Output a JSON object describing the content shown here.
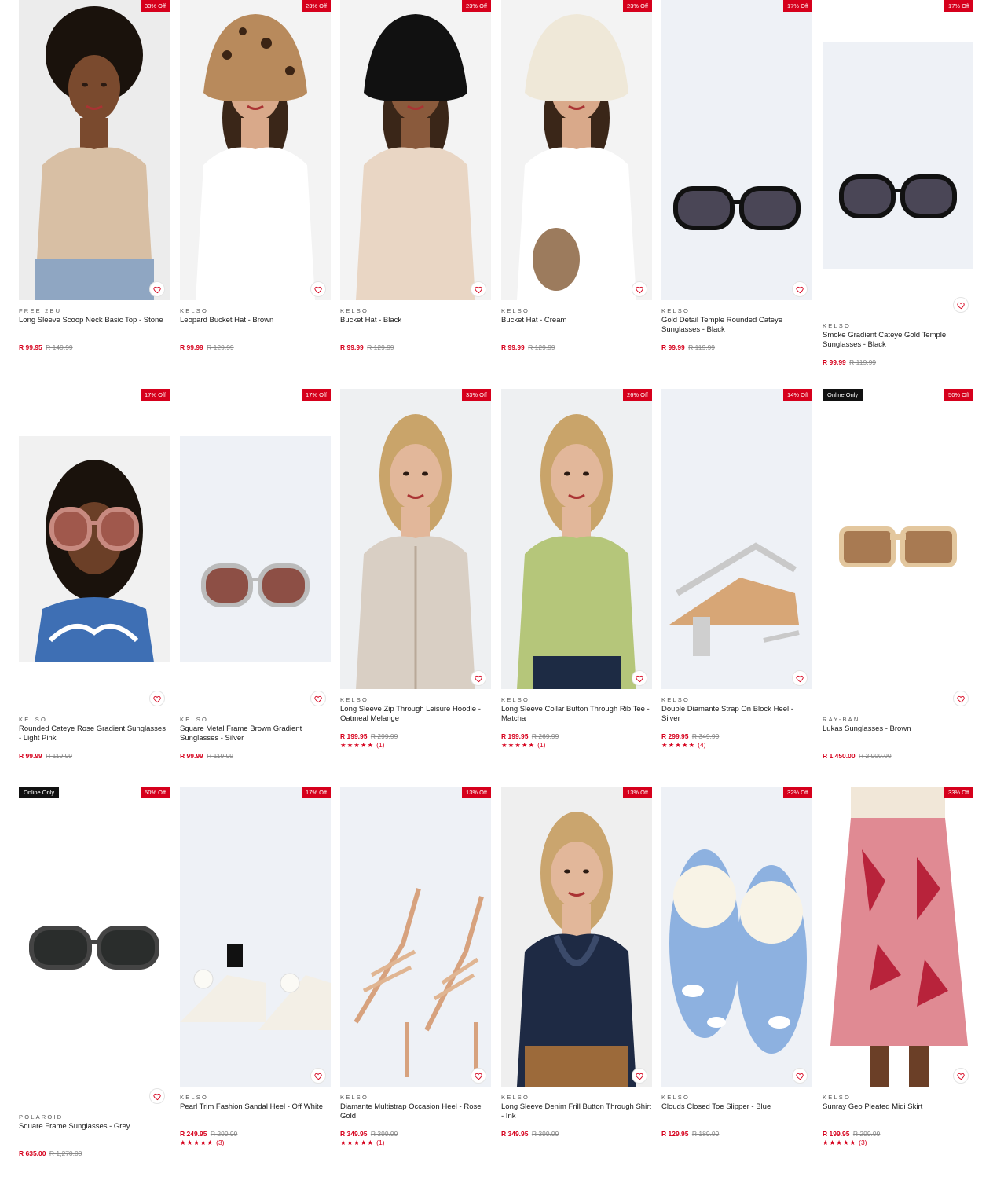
{
  "theme": {
    "accent": "#d6001c",
    "online_badge": "#111111"
  },
  "products": [
    {
      "brand": "FREE 2BU",
      "name": "Long Sleeve Scoop Neck Basic Top - Stone",
      "price": "R 99.95",
      "was_price": "R 149.99",
      "discount": "33% Off",
      "online_only": "",
      "rating_stars": "",
      "rating_count": "",
      "image": "model-scoop-neck-top-stone",
      "wishlist_icon": "heart-outline-icon"
    },
    {
      "brand": "KELSO",
      "name": "Leopard Bucket Hat - Brown",
      "price": "R 99.99",
      "was_price": "R 129.99",
      "discount": "23% Off",
      "online_only": "",
      "rating_stars": "",
      "rating_count": "",
      "image": "model-leopard-bucket-hat",
      "wishlist_icon": "heart-outline-icon"
    },
    {
      "brand": "KELSO",
      "name": "Bucket Hat - Black",
      "price": "R 99.99",
      "was_price": "R 129.99",
      "discount": "23% Off",
      "online_only": "",
      "rating_stars": "",
      "rating_count": "",
      "image": "model-black-bucket-hat",
      "wishlist_icon": "heart-outline-icon"
    },
    {
      "brand": "KELSO",
      "name": "Bucket Hat - Cream",
      "price": "R 99.99",
      "was_price": "R 129.99",
      "discount": "23% Off",
      "online_only": "",
      "rating_stars": "",
      "rating_count": "",
      "image": "model-cream-bucket-hat",
      "wishlist_icon": "heart-outline-icon"
    },
    {
      "brand": "KELSO",
      "name": "Gold Detail Temple Rounded Cateye Sunglasses - Black",
      "price": "R 99.99",
      "was_price": "R 119.99",
      "discount": "17% Off",
      "online_only": "",
      "rating_stars": "",
      "rating_count": "",
      "image": "sunglasses-black-cateye",
      "wishlist_icon": "heart-outline-icon"
    },
    {
      "brand": "KELSO",
      "name": "Smoke Gradient Cateye Gold Temple Sunglasses - Black",
      "price": "R 99.99",
      "was_price": "R 119.99",
      "discount": "17% Off",
      "online_only": "",
      "rating_stars": "",
      "rating_count": "",
      "image": "sunglasses-smoke-cateye",
      "wishlist_icon": "heart-outline-icon"
    },
    {
      "brand": "KELSO",
      "name": "Rounded Cateye Rose Gradient Sunglasses - Light Pink",
      "price": "R 99.99",
      "was_price": "R 119.99",
      "discount": "17% Off",
      "online_only": "",
      "rating_stars": "",
      "rating_count": "",
      "image": "model-rose-sunglasses",
      "wishlist_icon": "heart-outline-icon"
    },
    {
      "brand": "KELSO",
      "name": "Square Metal Frame Brown Gradient Sunglasses - Silver",
      "price": "R 99.99",
      "was_price": "R 119.99",
      "discount": "17% Off",
      "online_only": "",
      "rating_stars": "",
      "rating_count": "",
      "image": "sunglasses-metal-brown",
      "wishlist_icon": "heart-outline-icon"
    },
    {
      "brand": "KELSO",
      "name": "Long Sleeve Zip Through Leisure Hoodie - Oatmeal Melange",
      "price": "R 199.95",
      "was_price": "R 299.99",
      "discount": "33% Off",
      "online_only": "",
      "rating_stars": "★★★★★",
      "rating_count": "(1)",
      "image": "model-oatmeal-hoodie",
      "wishlist_icon": "heart-outline-icon"
    },
    {
      "brand": "KELSO",
      "name": "Long Sleeve Collar Button Through Rib Tee - Matcha",
      "price": "R 199.95",
      "was_price": "R 269.99",
      "discount": "26% Off",
      "online_only": "",
      "rating_stars": "★★★★★",
      "rating_count": "(1)",
      "image": "model-matcha-rib-tee",
      "wishlist_icon": "heart-outline-icon"
    },
    {
      "brand": "KELSO",
      "name": "Double Diamante Strap On Block Heel - Silver",
      "price": "R 299.95",
      "was_price": "R 349.99",
      "discount": "14% Off",
      "online_only": "",
      "rating_stars": "★★★★★",
      "rating_count": "(4)",
      "image": "silver-block-heel",
      "wishlist_icon": "heart-outline-icon"
    },
    {
      "brand": "RAY-BAN",
      "name": "Lukas Sunglasses - Brown",
      "price": "R 1,450.00",
      "was_price": "R 2,900.00",
      "discount": "50% Off",
      "online_only": "Online Only",
      "rating_stars": "",
      "rating_count": "",
      "image": "sunglasses-rayban-lukas",
      "wishlist_icon": "heart-outline-icon"
    },
    {
      "brand": "POLAROID",
      "name": "Square Frame Sunglasses - Grey",
      "price": "R 635.00",
      "was_price": "R 1,270.00",
      "discount": "50% Off",
      "online_only": "Online Only",
      "rating_stars": "",
      "rating_count": "",
      "image": "sunglasses-polaroid-grey",
      "wishlist_icon": "heart-outline-icon"
    },
    {
      "brand": "KELSO",
      "name": "Pearl Trim Fashion Sandal Heel - Off White",
      "price": "R 249.95",
      "was_price": "R 299.99",
      "discount": "17% Off",
      "online_only": "",
      "rating_stars": "★★★★★",
      "rating_count": "(3)",
      "image": "pearl-sandal-heel",
      "wishlist_icon": "heart-outline-icon"
    },
    {
      "brand": "KELSO",
      "name": "Diamante Multistrap Occasion Heel - Rose Gold",
      "price": "R 349.95",
      "was_price": "R 399.99",
      "discount": "13% Off",
      "online_only": "",
      "rating_stars": "★★★★★",
      "rating_count": "(1)",
      "image": "rose-gold-heel",
      "wishlist_icon": "heart-outline-icon"
    },
    {
      "brand": "KELSO",
      "name": "Long Sleeve Denim Frill Button Through Shirt - Ink",
      "price": "R 349.95",
      "was_price": "R 399.99",
      "discount": "13% Off",
      "online_only": "",
      "rating_stars": "",
      "rating_count": "",
      "image": "model-denim-frill-shirt",
      "wishlist_icon": "heart-outline-icon"
    },
    {
      "brand": "KELSO",
      "name": "Clouds Closed Toe Slipper - Blue",
      "price": "R 129.95",
      "was_price": "R 189.99",
      "discount": "32% Off",
      "online_only": "",
      "rating_stars": "",
      "rating_count": "",
      "image": "cloud-slippers",
      "wishlist_icon": "heart-outline-icon"
    },
    {
      "brand": "KELSO",
      "name": "Sunray Geo Pleated Midi Skirt",
      "price": "R 199.95",
      "was_price": "R 299.99",
      "discount": "33% Off",
      "online_only": "",
      "rating_stars": "★★★★★",
      "rating_count": "(3)",
      "image": "pleated-midi-skirt",
      "wishlist_icon": "heart-outline-icon"
    }
  ]
}
